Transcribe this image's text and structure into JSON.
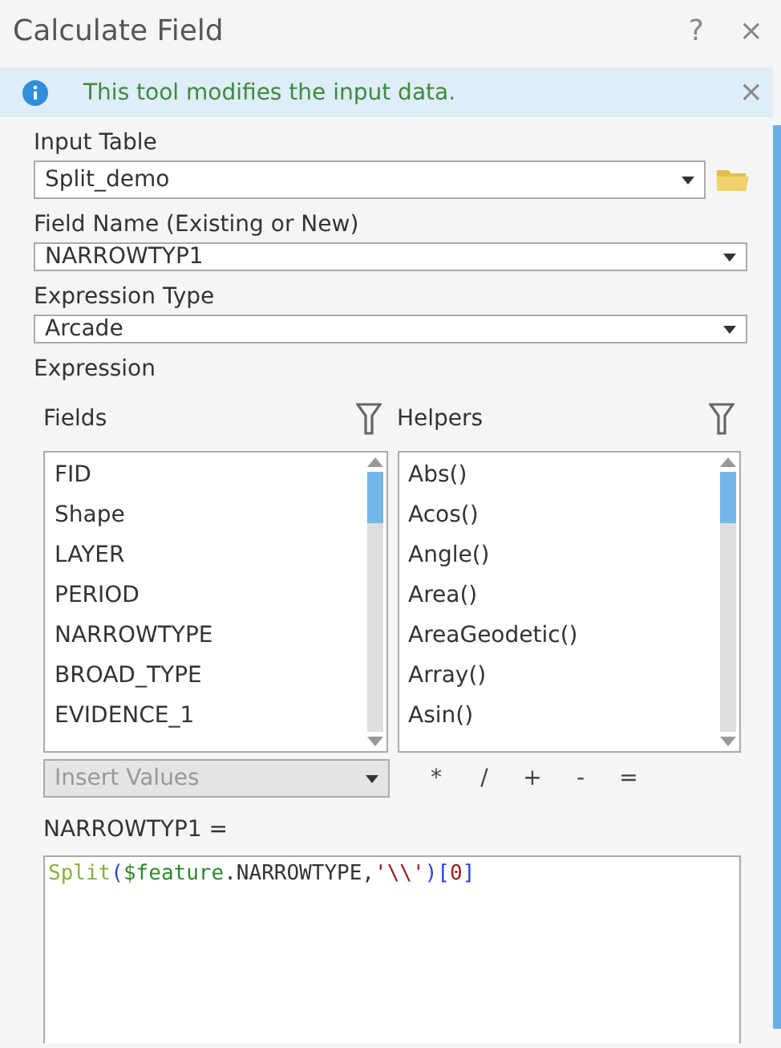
{
  "window": {
    "title": "Calculate Field",
    "help": "?",
    "close": "×"
  },
  "banner": {
    "message": "This tool modifies the input data.",
    "close": "×"
  },
  "input_table": {
    "label": "Input Table",
    "value": "Split_demo"
  },
  "field_name": {
    "label": "Field Name (Existing or New)",
    "value": "NARROWTYP1"
  },
  "expression_type": {
    "label": "Expression Type",
    "value": "Arcade"
  },
  "expression": {
    "label": "Expression",
    "fields": {
      "title": "Fields",
      "items": [
        "FID",
        "Shape",
        "LAYER",
        "PERIOD",
        "NARROWTYPE",
        "BROAD_TYPE",
        "EVIDENCE_1"
      ]
    },
    "helpers": {
      "title": "Helpers",
      "items": [
        "Abs()",
        "Acos()",
        "Angle()",
        "Area()",
        "AreaGeodetic()",
        "Array()",
        "Asin()"
      ]
    },
    "insert_values": {
      "placeholder": "Insert Values",
      "disabled": true
    },
    "operators": [
      "*",
      "/",
      "+",
      "-",
      "="
    ],
    "target": "NARROWTYP1 =",
    "code": [
      {
        "kind": "function",
        "text": "Split"
      },
      {
        "kind": "bracket",
        "text": "("
      },
      {
        "kind": "variable",
        "text": "$feature"
      },
      {
        "kind": "plain",
        "text": ".NARROWTYPE,"
      },
      {
        "kind": "string",
        "text": "'\\\\'"
      },
      {
        "kind": "bracket",
        "text": ")["
      },
      {
        "kind": "number",
        "text": "0"
      },
      {
        "kind": "bracket",
        "text": "]"
      }
    ]
  }
}
